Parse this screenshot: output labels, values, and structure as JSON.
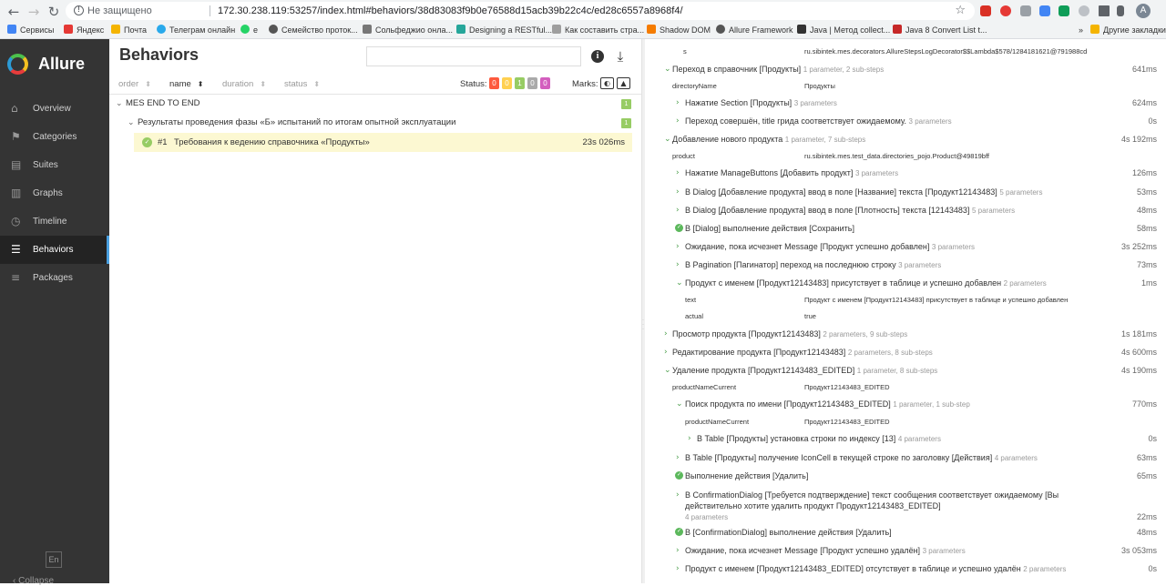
{
  "browser": {
    "not_secure": "Не защищено",
    "url": "172.30.238.119:53257/index.html#behaviors/38d83083f9b0e76588d15acb39b22c4c/ed28c6557a8968f4/",
    "avatar_letter": "A"
  },
  "bookmarks": {
    "items": [
      "Сервисы",
      "Яндекс",
      "Почта",
      "Телеграм онлайн",
      "е",
      "Семейство проток...",
      "Сольфеджио онла...",
      "Designing a RESTful...",
      "Как составить стра...",
      "Shadow DOM",
      "Allure Framework",
      "Java | Метод collect...",
      "Java 8 Convert List t..."
    ],
    "more": "»",
    "other": "Другие закладки"
  },
  "sidebar": {
    "brand": "Allure",
    "items": [
      {
        "label": "Overview",
        "icon": "home-icon"
      },
      {
        "label": "Categories",
        "icon": "flag-icon"
      },
      {
        "label": "Suites",
        "icon": "briefcase-icon"
      },
      {
        "label": "Graphs",
        "icon": "bar-chart-icon"
      },
      {
        "label": "Timeline",
        "icon": "clock-icon"
      },
      {
        "label": "Behaviors",
        "icon": "list-icon"
      },
      {
        "label": "Packages",
        "icon": "packages-icon"
      }
    ],
    "lang": "En",
    "collapse": "Collapse"
  },
  "behaviors": {
    "title": "Behaviors",
    "sort": {
      "order": "order",
      "name": "name",
      "duration": "duration",
      "status": "status"
    },
    "status_label": "Status:",
    "status_counts": [
      {
        "value": "0",
        "color": "#fd5a3e"
      },
      {
        "value": "0",
        "color": "#ffd050"
      },
      {
        "value": "1",
        "color": "#97cc64"
      },
      {
        "value": "0",
        "color": "#aaaaaa"
      },
      {
        "value": "0",
        "color": "#d35ebe"
      }
    ],
    "marks_label": "Marks:",
    "tree": {
      "epic": {
        "label": "MES END TO END",
        "count": "1"
      },
      "feature": {
        "label": "Результаты проведения фазы «Б» испытаний по итогам опытной эксплуатации",
        "count": "1"
      },
      "case": {
        "num": "#1",
        "name": "Требования к ведению справочника «Продукты»",
        "duration": "23s 026ms"
      }
    }
  },
  "steps": {
    "s0_key": "s",
    "s0_val": "ru.sibintek.mes.decorators.AllureStepsLogDecorator$$Lambda$578/1284181621@791988cd",
    "s1": {
      "title": "Переход в справочник [Продукты]",
      "params": "1 parameter, 2 sub-steps",
      "dur": "641ms"
    },
    "s1_key": "directoryName",
    "s1_val": "Продукты",
    "s1a": {
      "title": "Нажатие Section [Продукты]",
      "params": "3 parameters",
      "dur": "624ms"
    },
    "s1b": {
      "title": "Переход совершён, title грида соответствует ожидаемому.",
      "params": "3 parameters",
      "dur": "0s"
    },
    "s2": {
      "title": "Добавление нового продукта",
      "params": "1 parameter, 7 sub-steps",
      "dur": "4s 192ms"
    },
    "s2_key": "product",
    "s2_val": "ru.sibintek.mes.test_data.directories_pojo.Product@49819bff",
    "s2a": {
      "title": "Нажатие ManageButtons [Добавить продукт]",
      "params": "3 parameters",
      "dur": "126ms"
    },
    "s2b": {
      "title": "В Dialog [Добавление продукта] ввод в поле [Название] текста [Продукт12143483]",
      "params": "5 parameters",
      "dur": "53ms"
    },
    "s2c": {
      "title": "В Dialog [Добавление продукта] ввод в поле [Плотность] текста [12143483]",
      "params": "5 parameters",
      "dur": "48ms"
    },
    "s2d": {
      "title": "В [Dialog] выполнение действия [Сохранить]",
      "params": "",
      "dur": "58ms"
    },
    "s2e": {
      "title": "Ожидание, пока исчезнет Message [Продукт успешно добавлен]",
      "params": "3 parameters",
      "dur": "3s 252ms"
    },
    "s2f": {
      "title": "В Pagination [Пагинатор] переход на последнюю строку",
      "params": "3 parameters",
      "dur": "73ms"
    },
    "s2g": {
      "title": "Продукт с именем [Продукт12143483] присутствует в таблице и успешно добавлен",
      "params": "2 parameters",
      "dur": "1ms"
    },
    "s2g_k1": "text",
    "s2g_v1": "Продукт с именем [Продукт12143483] присутствует в таблице и успешно добавлен",
    "s2g_k2": "actual",
    "s2g_v2": "true",
    "s3": {
      "title": "Просмотр продукта [Продукт12143483]",
      "params": "2 parameters, 9 sub-steps",
      "dur": "1s 181ms"
    },
    "s4": {
      "title": "Редактирование продукта [Продукт12143483]",
      "params": "2 parameters, 8 sub-steps",
      "dur": "4s 600ms"
    },
    "s5": {
      "title": "Удаление продукта [Продукт12143483_EDITED]",
      "params": "1 parameter, 8 sub-steps",
      "dur": "4s 190ms"
    },
    "s5_key": "productNameCurrent",
    "s5_val": "Продукт12143483_EDITED",
    "s5a": {
      "title": "Поиск продукта по имени [Продукт12143483_EDITED]",
      "params": "1 parameter, 1 sub-step",
      "dur": "770ms"
    },
    "s5a_key": "productNameCurrent",
    "s5a_val": "Продукт12143483_EDITED",
    "s5a1": {
      "title": "В Table [Продукты] установка строки по индексу [13]",
      "params": "4 parameters",
      "dur": "0s"
    },
    "s5b": {
      "title": "В Table [Продукты] получение IconCell в текущей строке по заголовку [Действия]",
      "params": "4 parameters",
      "dur": "63ms"
    },
    "s5c": {
      "title": "Выполнение действия [Удалить]",
      "params": "",
      "dur": "65ms"
    },
    "s5d_line1": "В ConfirmationDialog [Требуется подтверждение] текст сообщения соответствует ожидаемому [Вы",
    "s5d_line2": "действительно хотите удалить продукт Продукт12143483_EDITED]",
    "s5d_params": "4 parameters",
    "s5d_dur": "22ms",
    "s5e": {
      "title": "В [ConfirmationDialog] выполнение действия [Удалить]",
      "params": "",
      "dur": "48ms"
    },
    "s5f": {
      "title": "Ожидание, пока исчезнет Message [Продукт успешно удалён]",
      "params": "3 parameters",
      "dur": "3s 053ms"
    },
    "s5g": {
      "title": "Продукт с именем [Продукт12143483_EDITED] отсутствует в таблице и успешно удалён",
      "params": "2 parameters",
      "dur": "0s"
    }
  }
}
